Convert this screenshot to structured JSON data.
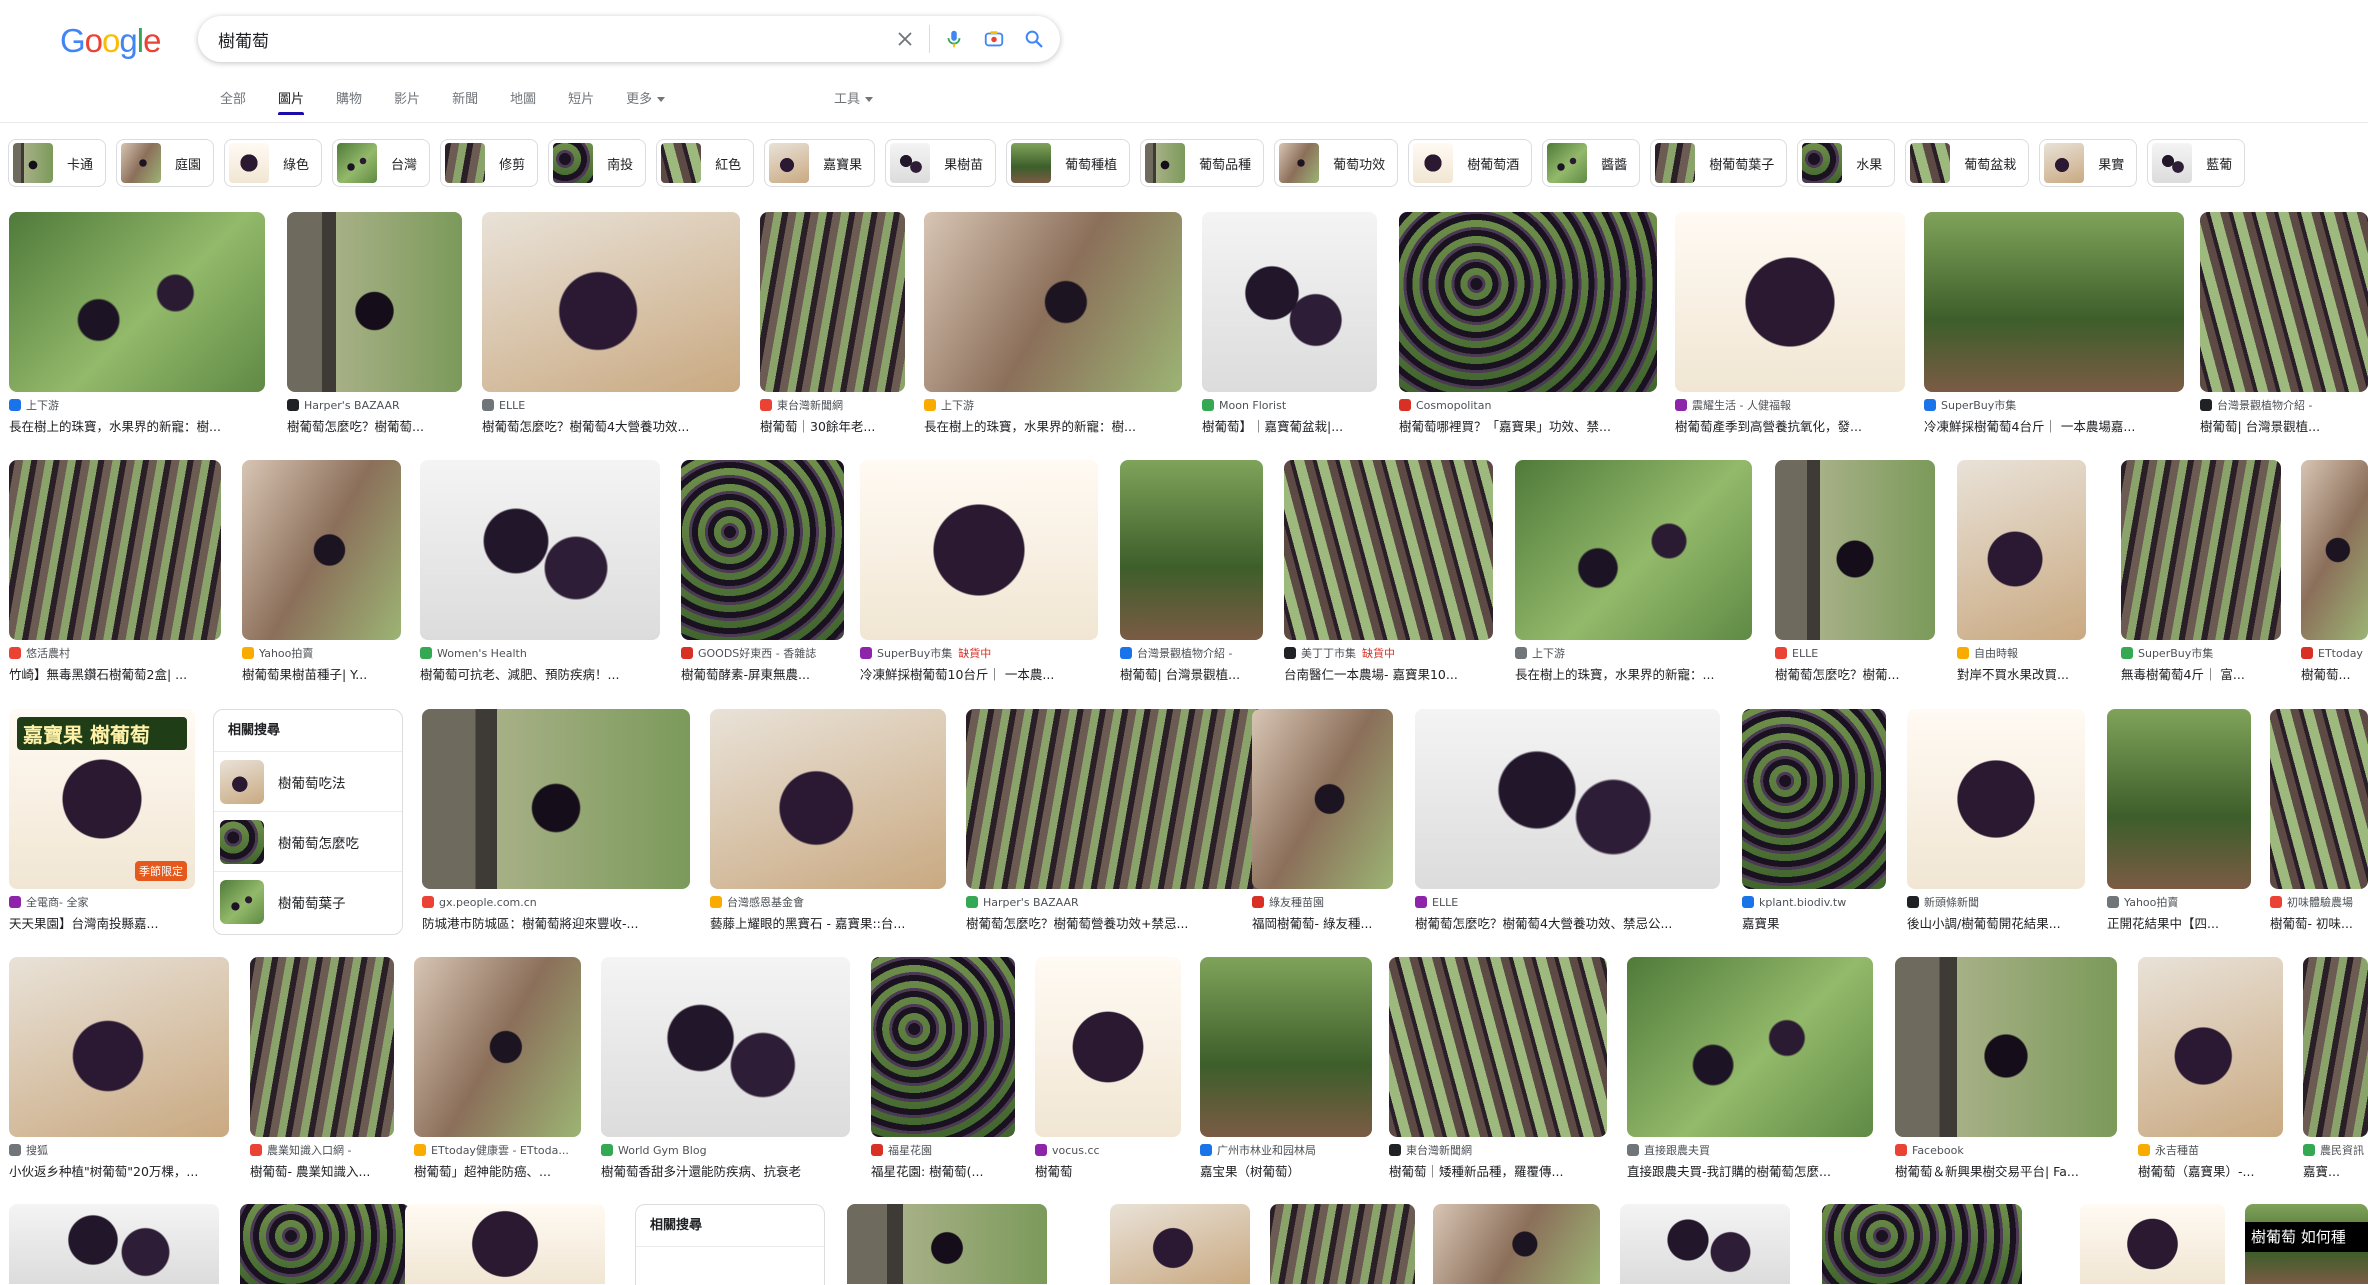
{
  "search": {
    "query": "樹葡萄",
    "logo_letters": [
      "G",
      "o",
      "o",
      "g",
      "l",
      "e"
    ],
    "logo_colors": [
      "#4285f4",
      "#ea4335",
      "#fbbc05",
      "#4285f4",
      "#34a853",
      "#ea4335"
    ]
  },
  "tabs": [
    "全部",
    "圖片",
    "購物",
    "影片",
    "新聞",
    "地圖",
    "短片"
  ],
  "more_label": "更多",
  "tools_label": "工具",
  "chips": [
    "卡通",
    "庭園",
    "綠色",
    "台灣",
    "修剪",
    "南投",
    "紅色",
    "嘉寶果",
    "果樹苗",
    "葡萄種植",
    "葡萄品種",
    "葡萄功效",
    "樹葡萄酒",
    "醬醬",
    "樹葡萄葉子",
    "水果",
    "葡萄盆栽",
    "果實",
    "藍葡"
  ],
  "results": {
    "row1": [
      {
        "source": "上下游",
        "title": "長在樹上的珠寶，水果界的新寵：樹..."
      },
      {
        "source": "Harper's BAZAAR",
        "title": "樹葡萄怎麼吃？樹葡萄..."
      },
      {
        "source": "ELLE",
        "title": "樹葡萄怎麼吃？樹葡萄4大營養功效..."
      },
      {
        "source": "東台灣新聞網",
        "title": "樹葡萄｜30餘年老..."
      },
      {
        "source": "上下游",
        "title": "長在樹上的珠寶，水果界的新寵：樹..."
      },
      {
        "source": "Moon Florist",
        "title": "樹葡萄】｜嘉寶葡盆栽|..."
      },
      {
        "source": "Cosmopolitan",
        "title": "樹葡萄哪裡買？「嘉寶果」功效、禁..."
      },
      {
        "source": "震耀生活 - 人健福報",
        "title": "樹葡萄產季到高營養抗氧化，發..."
      },
      {
        "source": "SuperBuy市集",
        "title": "冷凍鮮採樹葡萄4台斤｜ 一本農場嘉..."
      },
      {
        "source": "台灣景觀植物介紹 -",
        "title": "樹葡萄| 台灣景觀植..."
      }
    ],
    "row2": [
      {
        "source": "悠活農村",
        "title": "竹崎】無毒黑鑽石樹葡萄2盒| ..."
      },
      {
        "source": "Yahoo拍賣",
        "title": "樹葡萄果樹苗種子| Y..."
      },
      {
        "source": "Women's Health",
        "title": "樹葡萄可抗老、減肥、預防疾病！..."
      },
      {
        "source": "GOODS好東西 - 香雜誌",
        "title": "樹葡萄酵素-屏東無農..."
      },
      {
        "source": "SuperBuy市集",
        "badge": "缺貨中",
        "title": "冷凍鮮採樹葡萄10台斤｜ 一本農..."
      },
      {
        "source": "台灣景觀植物介紹 -",
        "title": "樹葡萄| 台灣景觀植..."
      },
      {
        "source": "美丁丁市集",
        "badge": "缺貨中",
        "title": "台南醫仁一本農場- 嘉寶果10..."
      },
      {
        "source": "上下游",
        "title": "長在樹上的珠寶，水果界的新寵：..."
      },
      {
        "source": "ELLE",
        "title": "樹葡萄怎麼吃？樹葡..."
      },
      {
        "source": "自由時報",
        "title": "對岸不買水果改買..."
      },
      {
        "source": "SuperBuy市集",
        "title": "無毒樹葡萄4斤｜ 富..."
      },
      {
        "source": "ETtoday",
        "title": "樹葡萄..."
      }
    ],
    "row3": [
      {
        "source": "全電商- 全家",
        "title": "天天果園】台灣南投縣嘉..."
      },
      {
        "source": "gx.people.com.cn",
        "title": "防城港市防城區：樹葡萄將迎來豐收-..."
      },
      {
        "source": "台灣感恩基金會",
        "title": "藝藤上耀眼的黑寶石 - 嘉寶果::台..."
      },
      {
        "source": "Harper's BAZAAR",
        "title": "樹葡萄怎麼吃？樹葡萄營養功效+禁忌..."
      },
      {
        "source": "綠友種苗園",
        "title": "福岡樹葡萄- 綠友種..."
      },
      {
        "source": "ELLE",
        "title": "樹葡萄怎麼吃？樹葡萄4大營養功效、禁忌公..."
      },
      {
        "source": "kplant.biodiv.tw",
        "title": "嘉寶果"
      },
      {
        "source": "新頭條新聞",
        "title": "後山小調/樹葡萄開花結果..."
      },
      {
        "source": "Yahoo拍賣",
        "title": "正開花結果中【四..."
      },
      {
        "source": "初味體驗農場",
        "title": "樹葡萄- 初味..."
      }
    ],
    "row4": [
      {
        "source": "搜狐",
        "title": "小伙返乡种植\"树葡萄\"20万棵，..."
      },
      {
        "source": "農業知識入口網 -",
        "title": "樹葡萄- 農業知識入..."
      },
      {
        "source": "ETtoday健康雲 - ETtoda...",
        "title": "樹葡萄」超神能防癌、..."
      },
      {
        "source": "World Gym Blog",
        "title": "樹葡萄香甜多汁還能防疾病、抗衰老"
      },
      {
        "source": "福星花園",
        "title": "福星花園: 樹葡萄(..."
      },
      {
        "source": "vocus.cc",
        "title": "樹葡萄"
      },
      {
        "source": "广州市林业和园林局",
        "title": "嘉宝果（树葡萄）"
      },
      {
        "source": "東台灣新聞網",
        "title": "樹葡萄｜矮種新品種，羅覆傳..."
      },
      {
        "source": "直接跟農夫買",
        "title": "直接跟農夫買-我訂購的樹葡萄怎麼..."
      },
      {
        "source": "Facebook",
        "title": "樹葡萄＆新興果樹交易平台| Fa..."
      },
      {
        "source": "永吉種苗",
        "title": "樹葡萄（嘉寶果）-..."
      },
      {
        "source": "農民資訊",
        "title": "嘉寶..."
      }
    ]
  },
  "related": {
    "heading": "相關搜尋",
    "items": [
      "樹葡萄吃法",
      "樹葡萄怎麼吃",
      "樹葡萄葉子"
    ]
  },
  "related2_heading": "相關搜尋",
  "overlay_texts": {
    "promo_title": "嘉寶果 樹葡萄",
    "promo_badge": "季節限定",
    "row5_caption": "樹葡萄 如何種"
  }
}
